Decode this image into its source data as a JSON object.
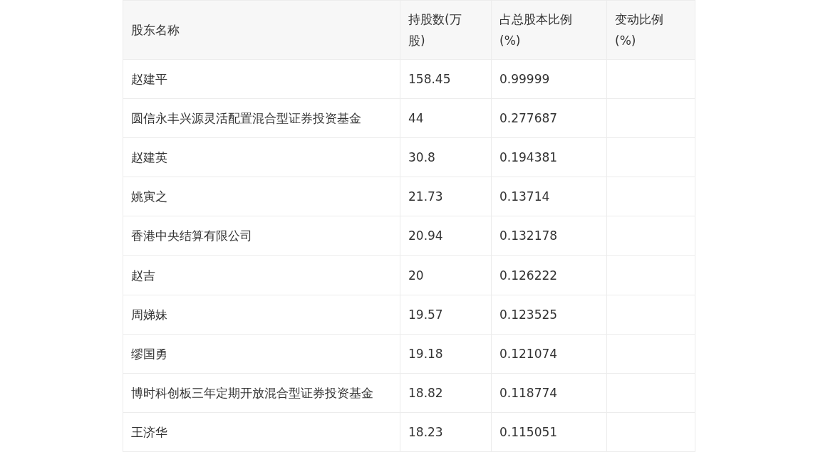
{
  "table": {
    "columns": [
      "股东名称",
      "持股数(万股)",
      "占总股本比例(%)",
      "变动比例(%)"
    ],
    "rows": [
      {
        "name": "赵建平",
        "shares": "158.45",
        "ratio": "0.99999"
      },
      {
        "name": "圆信永丰兴源灵活配置混合型证券投资基金",
        "shares": "44",
        "ratio": "0.277687"
      },
      {
        "name": "赵建英",
        "shares": "30.8",
        "ratio": "0.194381"
      },
      {
        "name": "姚寅之",
        "shares": "21.73",
        "ratio": "0.13714"
      },
      {
        "name": "香港中央结算有限公司",
        "shares": "20.94",
        "ratio": "0.132178"
      },
      {
        "name": "赵吉",
        "shares": "20",
        "ratio": "0.126222"
      },
      {
        "name": "周娣妹",
        "shares": "19.57",
        "ratio": "0.123525"
      },
      {
        "name": "缪国勇",
        "shares": "19.18",
        "ratio": "0.121074"
      },
      {
        "name": "博时科创板三年定期开放混合型证券投资基金",
        "shares": "18.82",
        "ratio": "0.118774"
      },
      {
        "name": "王济华",
        "shares": "18.23",
        "ratio": "0.115051"
      }
    ]
  }
}
